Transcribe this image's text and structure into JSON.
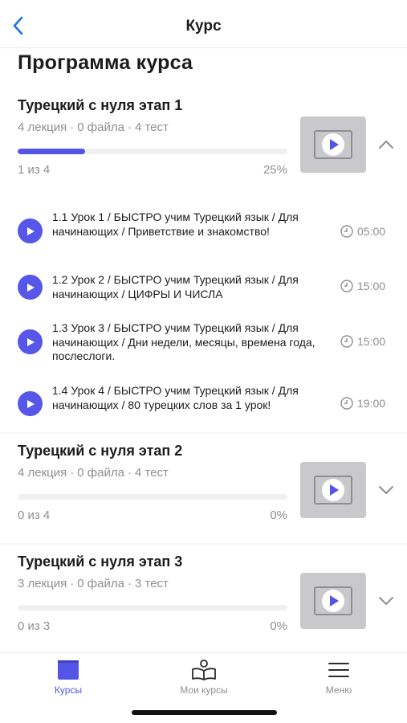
{
  "nav": {
    "title": "Курс"
  },
  "page_title": "Программа курса",
  "modules": [
    {
      "title": "Турецкий с нуля этап 1",
      "meta": {
        "lectures": "4 лекция",
        "files": "0 файла",
        "tests": "4 тест"
      },
      "progress_label": "1 из 4",
      "progress_percent_label": "25%",
      "progress": 0.25,
      "expanded": true,
      "lessons": [
        {
          "title": "1.1 Урок 1 / БЫСТРО учим Турецкий язык / Для начинающих / Приветствие и знакомство!",
          "duration": "05:00"
        },
        {
          "title": "1.2 Урок 2 / БЫСТРО учим Турецкий язык / Для начинающих / ЦИФРЫ И ЧИСЛА",
          "duration": "15:00"
        },
        {
          "title": "1.3 Урок 3 / БЫСТРО учим Турецкий язык / Для начинающих / Дни недели, месяцы, времена года, послеслоги.",
          "duration": "15:00"
        },
        {
          "title": "1.4 Урок 4 / БЫСТРО учим Турецкий язык / Для начинающих / 80 турецких слов за 1 урок!",
          "duration": "19:00"
        }
      ]
    },
    {
      "title": "Турецкий с нуля этап 2",
      "meta": {
        "lectures": "4 лекция",
        "files": "0 файла",
        "tests": "4 тест"
      },
      "progress_label": "0 из 4",
      "progress_percent_label": "0%",
      "progress": 0,
      "expanded": false
    },
    {
      "title": "Турецкий с нуля этап 3",
      "meta": {
        "lectures": "3 лекция",
        "files": "0 файла",
        "tests": "3 тест"
      },
      "progress_label": "0 из 3",
      "progress_percent_label": "0%",
      "progress": 0,
      "expanded": false
    }
  ],
  "tabbar": {
    "items": [
      {
        "label": "Курсы",
        "icon": "book-icon",
        "active": true
      },
      {
        "label": "Мои курсы",
        "icon": "reader-icon",
        "active": false
      },
      {
        "label": "Меню",
        "icon": "menu-icon",
        "active": false
      }
    ]
  },
  "colors": {
    "accent": "#5454e6",
    "muted": "#8e8e93",
    "thumb": "#c9c9cc"
  }
}
